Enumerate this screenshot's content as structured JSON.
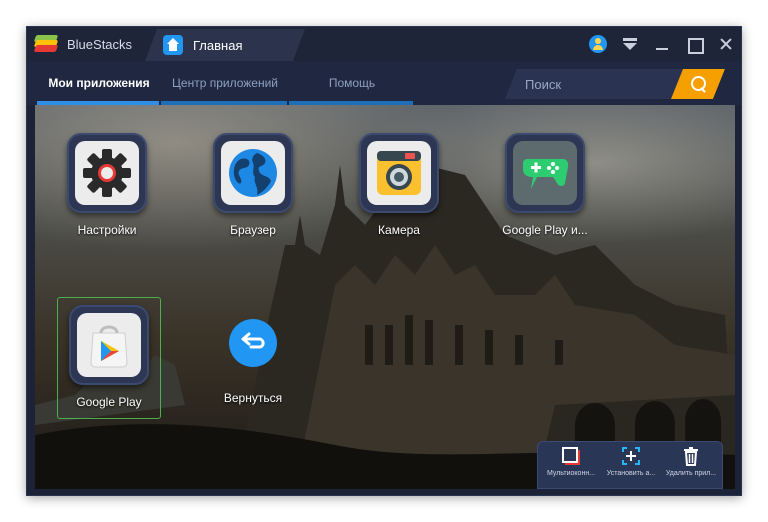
{
  "window": {
    "brand": "BlueStacks",
    "tab_home": "Главная"
  },
  "nav": {
    "tabs": [
      {
        "label": "Мои приложения",
        "active": true
      },
      {
        "label": "Центр приложений",
        "active": false
      },
      {
        "label": "Помощь",
        "active": false
      }
    ],
    "search_placeholder": "Поиск"
  },
  "apps": [
    {
      "label": "Настройки",
      "icon": "gear-icon"
    },
    {
      "label": "Браузер",
      "icon": "globe-icon"
    },
    {
      "label": "Камера",
      "icon": "camera-icon"
    },
    {
      "label": "Google Play и...",
      "icon": "gamepad-icon"
    },
    {
      "label": "Google Play",
      "icon": "play-store-icon",
      "selected": true
    }
  ],
  "back": {
    "label": "Вернуться",
    "icon": "back-arrow-icon"
  },
  "tray": [
    {
      "label": "Мультиоконн...",
      "icon": "multi-window-icon"
    },
    {
      "label": "Установить а...",
      "icon": "install-apk-icon"
    },
    {
      "label": "Удалить прил...",
      "icon": "trash-icon"
    }
  ],
  "colors": {
    "accent": "#2f8ee6",
    "search_button": "#f5a000",
    "selection": "#4caf50"
  }
}
